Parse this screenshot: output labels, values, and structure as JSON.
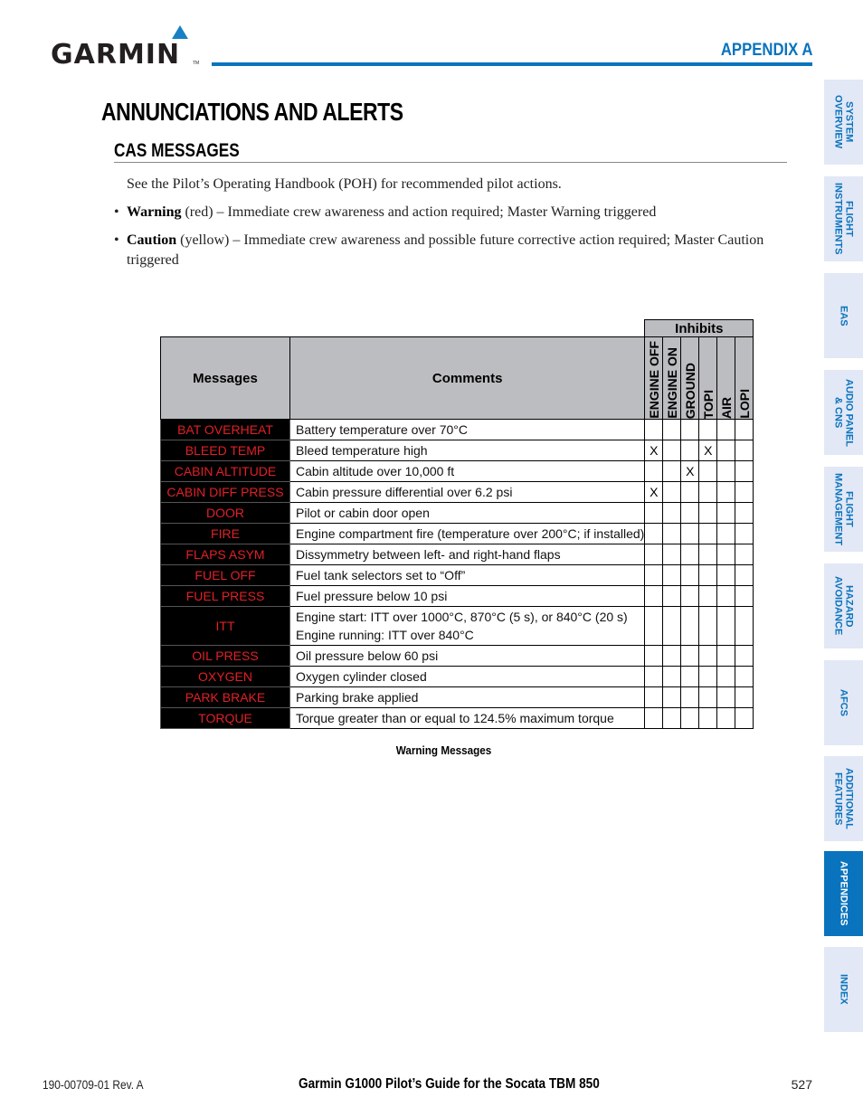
{
  "header": {
    "logo_text": "GARMIN",
    "logo_tm": "TM",
    "section_label": "APPENDIX A",
    "accent_color": "#0a73bd"
  },
  "page": {
    "title": "ANNUNCIATIONS AND ALERTS",
    "subtitle": "CAS MESSAGES",
    "intro": "See the Pilot’s Operating Handbook (POH) for recommended pilot actions.",
    "bullets": [
      {
        "term": "Warning",
        "text": " (red) – Immediate crew awareness and action required; Master Warning triggered"
      },
      {
        "term": "Caution",
        "text": " (yellow) – Immediate crew awareness and possible future corrective action required; Master Caution triggered"
      }
    ]
  },
  "table": {
    "inhibits_label": "Inhibits",
    "col_messages": "Messages",
    "col_comments": "Comments",
    "inhibit_columns": [
      "ENGINE OFF",
      "ENGINE ON",
      "GROUND",
      "TOPI",
      "AIR",
      "LOPI"
    ],
    "message_color": "#e02027",
    "rows": [
      {
        "message": "BAT OVERHEAT",
        "comment": [
          "Battery temperature over 70°C"
        ],
        "inhibits": [
          "",
          "",
          "",
          "",
          "",
          ""
        ]
      },
      {
        "message": "BLEED TEMP",
        "comment": [
          "Bleed temperature high"
        ],
        "inhibits": [
          "X",
          "",
          "",
          "X",
          "",
          ""
        ]
      },
      {
        "message": "CABIN ALTITUDE",
        "comment": [
          "Cabin altitude over 10,000 ft"
        ],
        "inhibits": [
          "",
          "",
          "X",
          "",
          "",
          ""
        ]
      },
      {
        "message": "CABIN DIFF PRESS",
        "comment": [
          "Cabin pressure differential over 6.2 psi"
        ],
        "inhibits": [
          "X",
          "",
          "",
          "",
          "",
          ""
        ]
      },
      {
        "message": "DOOR",
        "comment": [
          "Pilot or cabin door open"
        ],
        "inhibits": [
          "",
          "",
          "",
          "",
          "",
          ""
        ]
      },
      {
        "message": "FIRE",
        "comment": [
          "Engine compartment fire (temperature over 200°C; if installed)"
        ],
        "inhibits": [
          "",
          "",
          "",
          "",
          "",
          ""
        ]
      },
      {
        "message": "FLAPS ASYM",
        "comment": [
          "Dissymmetry between left- and right-hand flaps"
        ],
        "inhibits": [
          "",
          "",
          "",
          "",
          "",
          ""
        ]
      },
      {
        "message": "FUEL OFF",
        "comment": [
          "Fuel tank selectors set to “Off”"
        ],
        "inhibits": [
          "",
          "",
          "",
          "",
          "",
          ""
        ]
      },
      {
        "message": "FUEL PRESS",
        "comment": [
          "Fuel pressure below 10 psi"
        ],
        "inhibits": [
          "",
          "",
          "",
          "",
          "",
          ""
        ]
      },
      {
        "message": "ITT",
        "comment": [
          "Engine start: ITT over 1000°C, 870°C (5 s), or 840°C (20 s)",
          "Engine running: ITT over 840°C"
        ],
        "inhibits": [
          "",
          "",
          "",
          "",
          "",
          ""
        ]
      },
      {
        "message": "OIL PRESS",
        "comment": [
          "Oil pressure below 60 psi"
        ],
        "inhibits": [
          "",
          "",
          "",
          "",
          "",
          ""
        ]
      },
      {
        "message": "OXYGEN",
        "comment": [
          "Oxygen cylinder closed"
        ],
        "inhibits": [
          "",
          "",
          "",
          "",
          "",
          ""
        ]
      },
      {
        "message": "PARK BRAKE",
        "comment": [
          "Parking brake applied"
        ],
        "inhibits": [
          "",
          "",
          "",
          "",
          "",
          ""
        ]
      },
      {
        "message": "TORQUE",
        "comment": [
          "Torque greater than or equal to 124.5% maximum torque"
        ],
        "inhibits": [
          "",
          "",
          "",
          "",
          "",
          ""
        ]
      }
    ],
    "caption": "Warning Messages"
  },
  "side_tabs": [
    {
      "label": "SYSTEM\nOVERVIEW",
      "active": false
    },
    {
      "label": "FLIGHT\nINSTRUMENTS",
      "active": false
    },
    {
      "label": "EAS",
      "active": false
    },
    {
      "label": "AUDIO PANEL\n& CNS",
      "active": false
    },
    {
      "label": "FLIGHT\nMANAGEMENT",
      "active": false
    },
    {
      "label": "HAZARD\nAVOIDANCE",
      "active": false
    },
    {
      "label": "AFCS",
      "active": false
    },
    {
      "label": "ADDITIONAL\nFEATURES",
      "active": false
    },
    {
      "label": "APPENDICES",
      "active": true
    },
    {
      "label": "INDEX",
      "active": false
    }
  ],
  "footer": {
    "doc_number": "190-00709-01  Rev. A",
    "guide_title": "Garmin G1000 Pilot’s Guide for the Socata TBM 850",
    "page_number": "527"
  }
}
